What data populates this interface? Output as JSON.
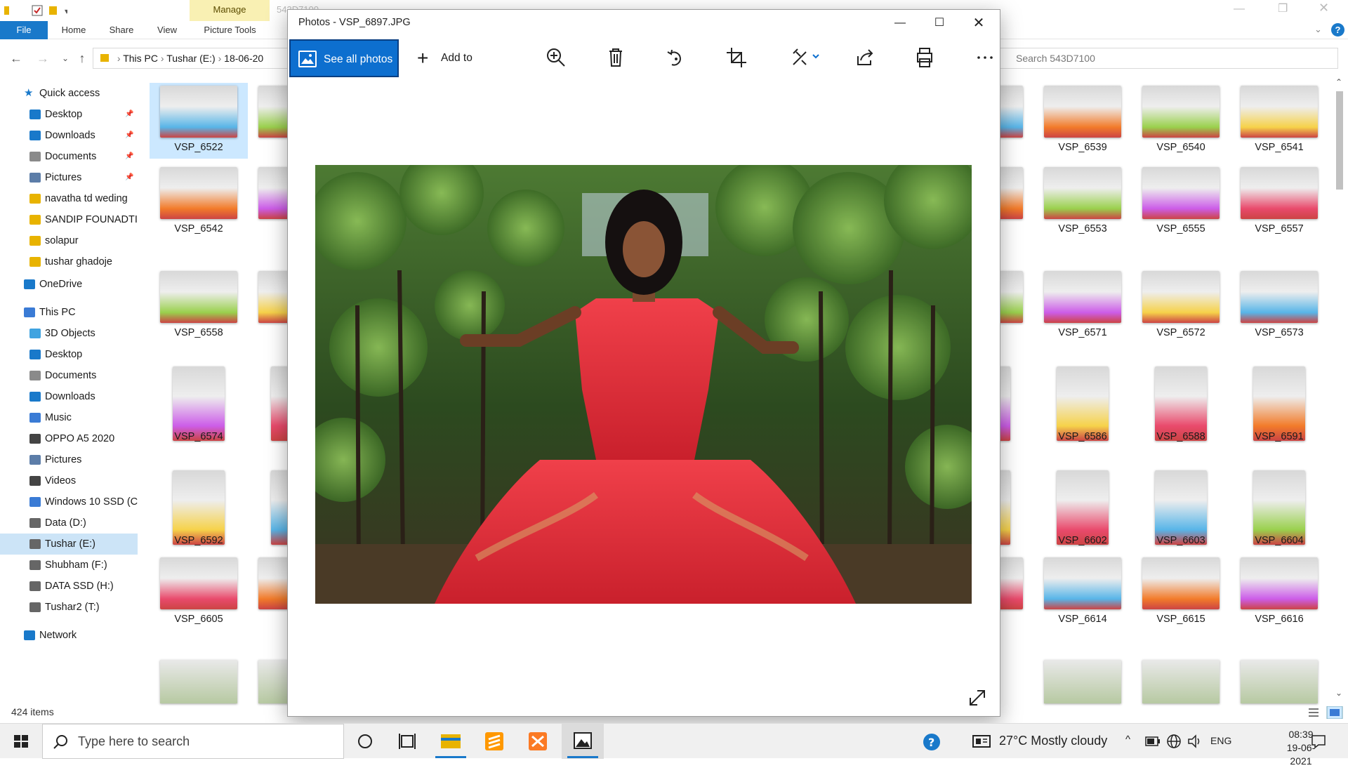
{
  "explorer": {
    "title_faded": "543D7100",
    "context_tab": "Manage",
    "ribbon_tabs": [
      "File",
      "Home",
      "Share",
      "View",
      "Picture Tools"
    ],
    "address": [
      "This PC",
      "Tushar (E:)",
      "18-06-20"
    ],
    "search_placeholder": "Search 543D7100",
    "status": "424 items",
    "nav": {
      "quick_access": "Quick access",
      "quick_items": [
        "Desktop",
        "Downloads",
        "Documents",
        "Pictures",
        "navatha td weding",
        "SANDIP FOUNADTI",
        "solapur",
        "tushar ghadoje"
      ],
      "onedrive": "OneDrive",
      "this_pc": "This PC",
      "pc_items": [
        "3D Objects",
        "Desktop",
        "Documents",
        "Downloads",
        "Music",
        "OPPO A5 2020",
        "Pictures",
        "Videos",
        "Windows 10 SSD (C",
        "Data (D:)",
        "Tushar (E:)",
        "Shubham (F:)",
        "DATA SSD (H:)",
        "Tushar2 (T:)"
      ],
      "network": "Network"
    },
    "col1": [
      "VSP_6522",
      "VSP_6542",
      "VSP_6558",
      "VSP_6574",
      "VSP_6592",
      "VSP_6605"
    ],
    "col2_prefix": [
      "VS",
      "VS",
      "VS",
      "VS",
      "VS",
      "VS"
    ],
    "partial_col": [
      "8",
      "2",
      "0",
      "5",
      "0",
      "3"
    ],
    "col4": [
      "VSP_6539",
      "VSP_6553",
      "VSP_6571",
      "VSP_6586",
      "VSP_6602",
      "VSP_6614"
    ],
    "col5": [
      "VSP_6540",
      "VSP_6555",
      "VSP_6572",
      "VSP_6588",
      "VSP_6603",
      "VSP_6615"
    ],
    "col6": [
      "VSP_6541",
      "VSP_6557",
      "VSP_6573",
      "VSP_6591",
      "VSP_6604",
      "VSP_6616"
    ]
  },
  "photos": {
    "title": "Photos - VSP_6897.JPG",
    "see_all": "See all photos",
    "add_to": "Add to",
    "toolbar_icons": [
      "zoom-in-icon",
      "delete-icon",
      "rotate-icon",
      "crop-icon",
      "edit-icon",
      "share-icon",
      "print-icon",
      "more-icon"
    ]
  },
  "taskbar": {
    "search_placeholder": "Type here to search",
    "weather": "27°C  Mostly cloudy",
    "lang": "ENG",
    "time": "08:39",
    "date": "19-06-2021"
  },
  "colors": {
    "accent": "#0d6fcf",
    "selection": "#cce8ff",
    "dress": "#e8323c"
  }
}
